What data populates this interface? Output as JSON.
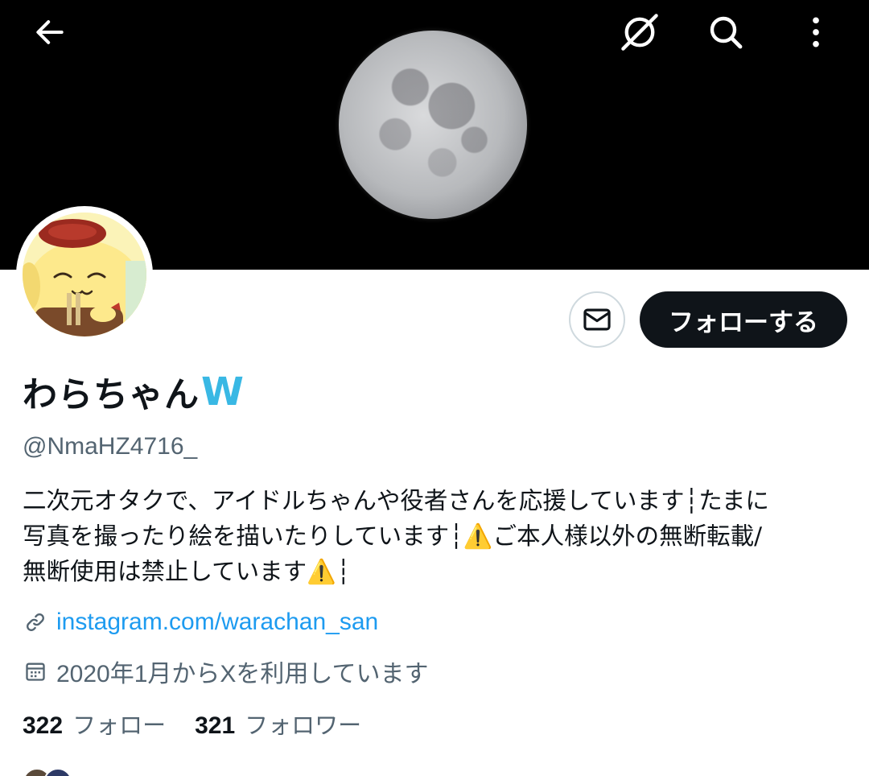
{
  "profile": {
    "display_name": "わらちゃん",
    "name_emoji": "W",
    "handle": "@NmaHZ4716_",
    "bio": "二次元オタクで、アイドルちゃんや役者さんを応援しています┆たまに\n写真を撮ったり絵を描いたりしています┆⚠️ご本人様以外の無断転載/\n無断使用は禁止しています⚠️┆",
    "website": "instagram.com/warachan_san",
    "joined": "2020年1月からXを利用しています",
    "following_count": "322",
    "following_label": "フォロー",
    "followers_count": "321",
    "followers_label": "フォロワー"
  },
  "actions": {
    "follow_label": "フォローする"
  },
  "icons": {
    "back": "arrow-left-icon",
    "grok": "grok-icon",
    "search": "search-icon",
    "more": "more-vertical-icon",
    "message": "mail-icon",
    "link": "link-icon",
    "calendar": "calendar-icon"
  },
  "colors": {
    "link": "#1d9bf0",
    "muted": "#536471",
    "button_bg": "#0f1419",
    "name_emoji": "#39b8e4"
  }
}
